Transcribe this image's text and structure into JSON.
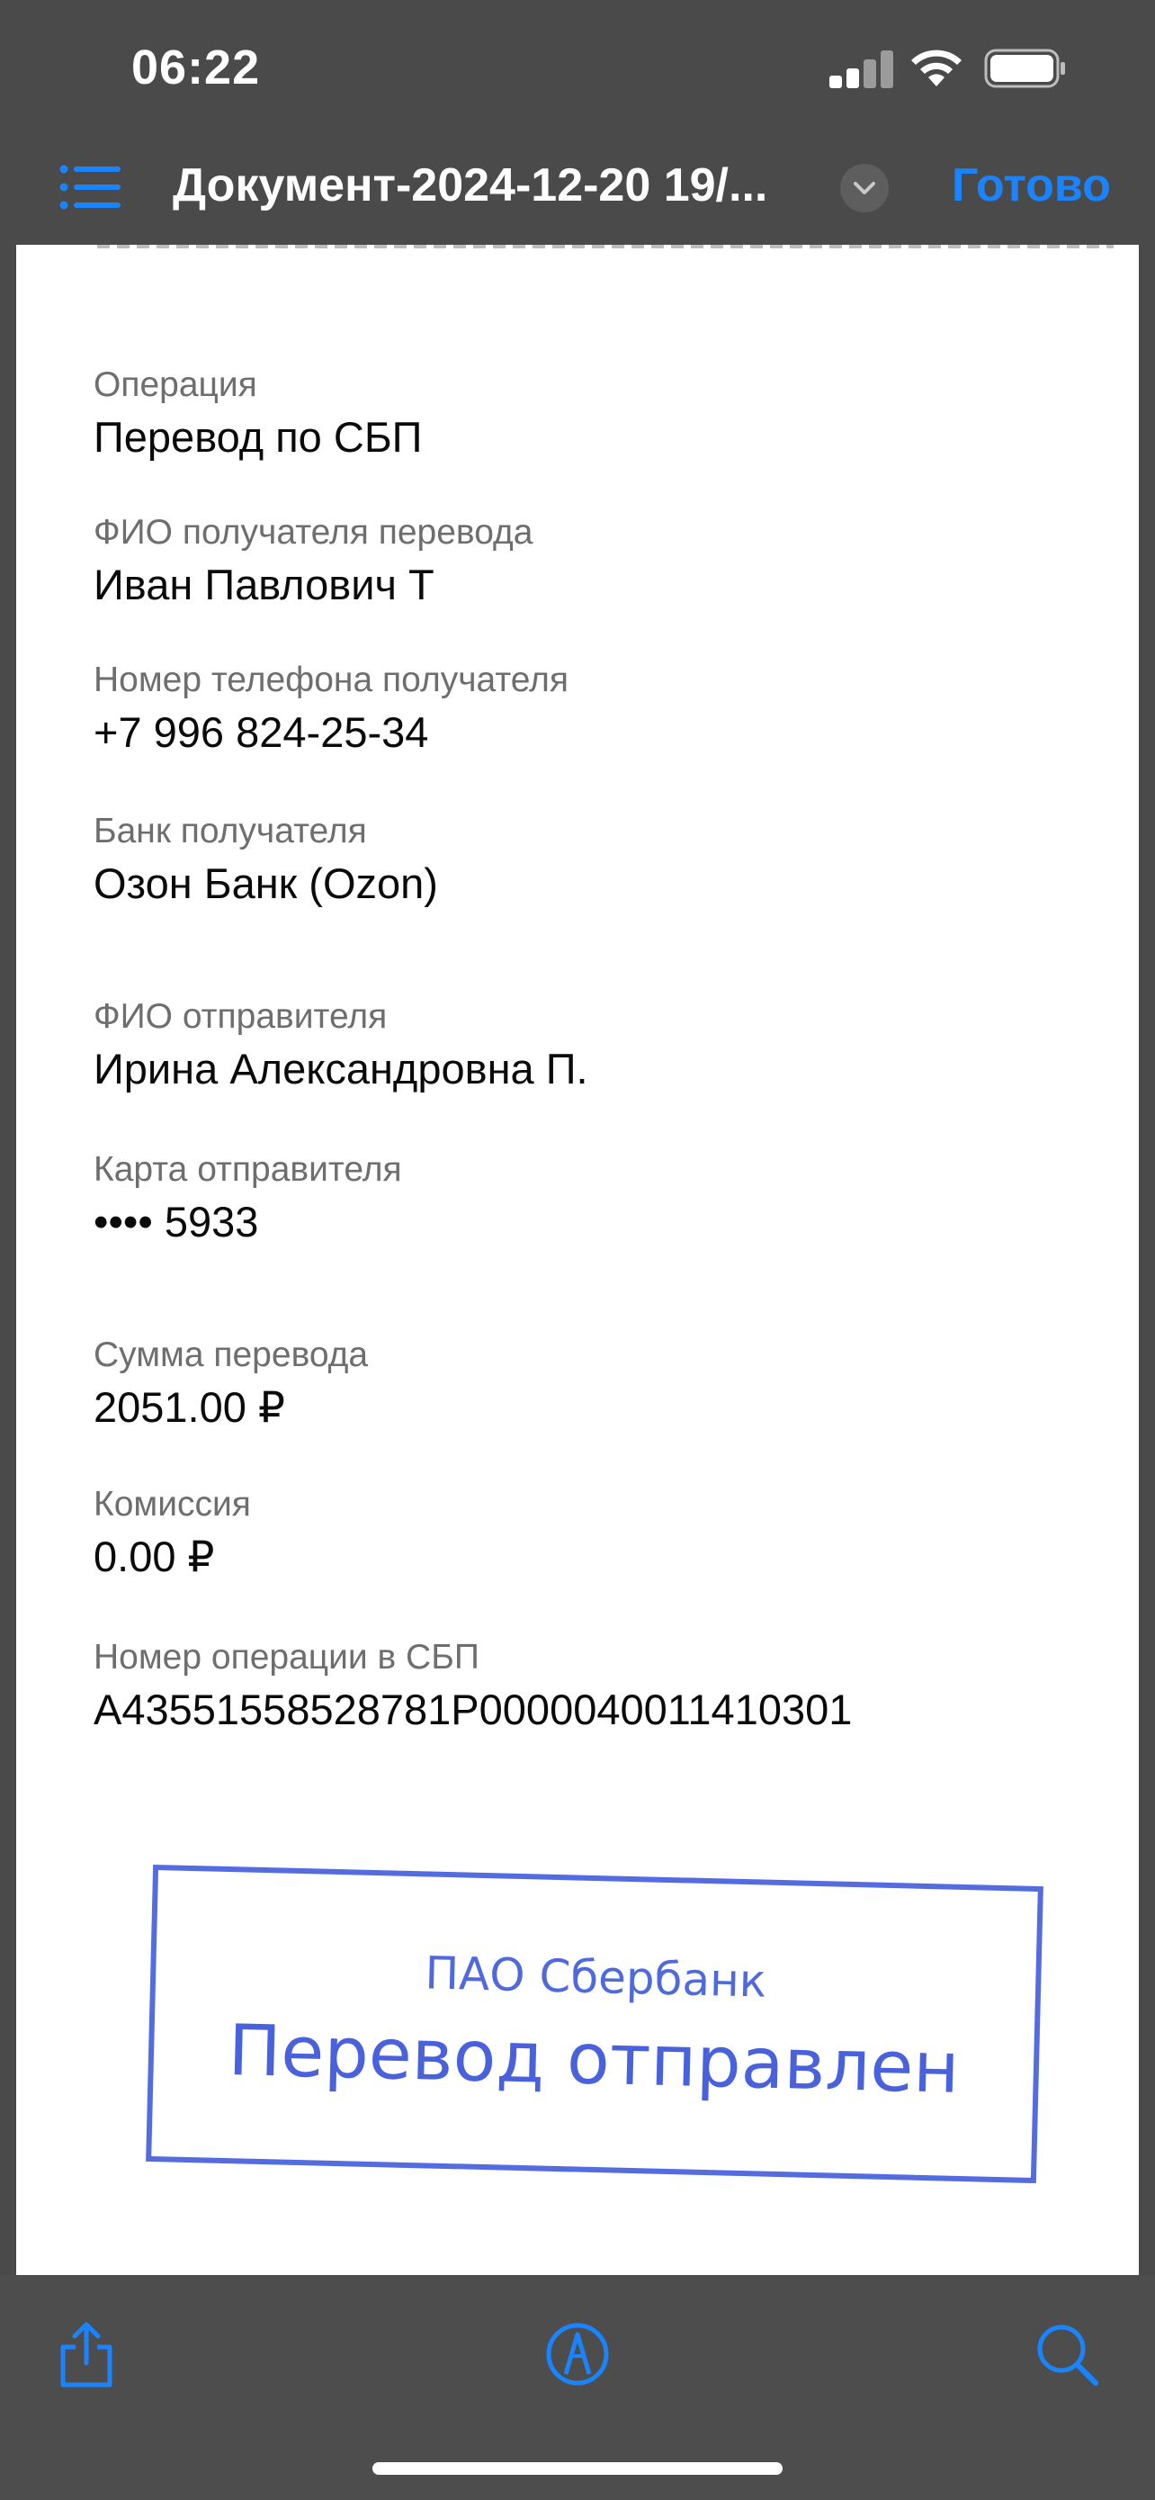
{
  "status_bar": {
    "time": "06:22"
  },
  "nav": {
    "title": "Документ-2024-12-20 19/...",
    "done_label": "Готово"
  },
  "receipt": {
    "fields": [
      {
        "label": "Операция",
        "value": "Перевод по СБП"
      },
      {
        "label": "ФИО получателя перевода",
        "value": "Иван Павлович Т"
      },
      {
        "label": "Номер телефона получателя",
        "value": "+7 996 824-25-34"
      },
      {
        "label": "Банк получателя",
        "value": "Озон Банк (Ozon)"
      },
      {
        "label": "ФИО отправителя",
        "value": "Ирина Александровна П."
      },
      {
        "label": "Карта отправителя",
        "value": "•••• 5933"
      },
      {
        "label": "Сумма перевода",
        "value": "2051.00  ₽"
      },
      {
        "label": "Комиссия",
        "value": "0.00  ₽"
      },
      {
        "label": "Номер операции в СБП",
        "value": "A43551558528781P0000040011410301"
      }
    ],
    "stamp": {
      "bank": "ПАО Сбербанк",
      "text": "Перевод отправлен",
      "color": "#3652d9"
    }
  },
  "toolbar": {
    "icons": [
      "share-icon",
      "markup-icon",
      "search-icon"
    ]
  },
  "colors": {
    "accent": "#1a84ff",
    "chrome": "#4a4a4a"
  }
}
